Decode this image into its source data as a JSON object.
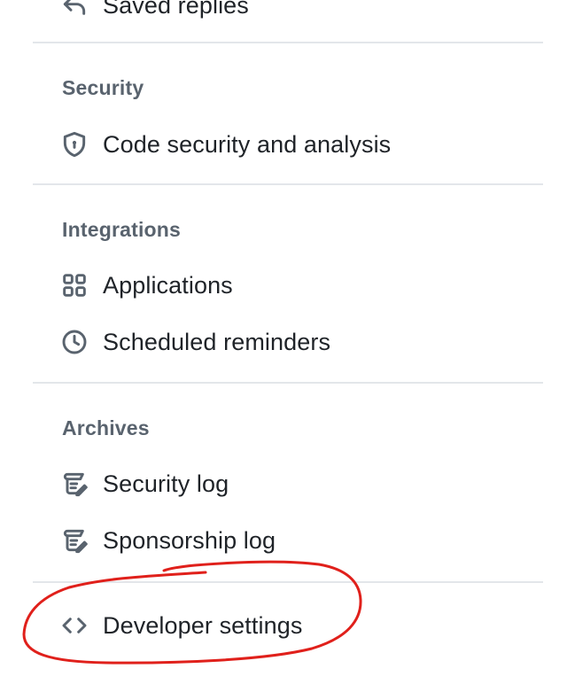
{
  "top_partial": {
    "label": "Saved replies",
    "icon": "reply-icon"
  },
  "sections": {
    "security": {
      "heading": "Security",
      "items": [
        {
          "label": "Code security and analysis",
          "icon": "shield-lock-icon"
        }
      ]
    },
    "integrations": {
      "heading": "Integrations",
      "items": [
        {
          "label": "Applications",
          "icon": "apps-grid-icon"
        },
        {
          "label": "Scheduled reminders",
          "icon": "clock-icon"
        }
      ]
    },
    "archives": {
      "heading": "Archives",
      "items": [
        {
          "label": "Security log",
          "icon": "log-icon"
        },
        {
          "label": "Sponsorship log",
          "icon": "log-icon"
        }
      ]
    }
  },
  "developer_settings": {
    "label": "Developer settings",
    "icon": "code-icon"
  },
  "colors": {
    "heading": "#59636e",
    "text": "#1f2328",
    "divider": "#e3e6ea",
    "annotation": "#e0201b"
  }
}
